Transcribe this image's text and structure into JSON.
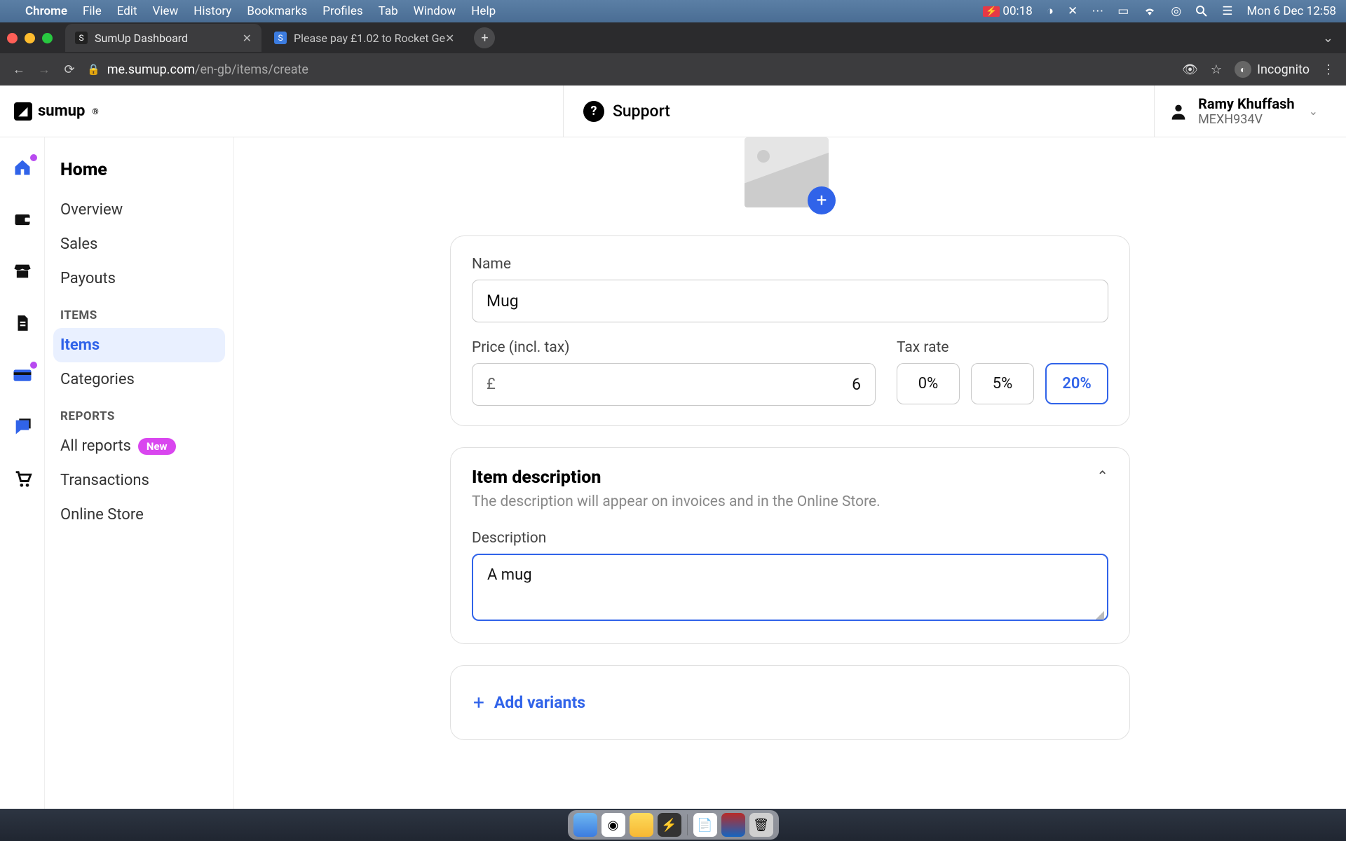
{
  "menubar": {
    "app": "Chrome",
    "menus": [
      "File",
      "Edit",
      "View",
      "History",
      "Bookmarks",
      "Profiles",
      "Tab",
      "Window",
      "Help"
    ],
    "battery_time": "00:18",
    "clock": "Mon 6 Dec  12:58"
  },
  "browser": {
    "tabs": [
      {
        "title": "SumUp Dashboard",
        "active": true
      },
      {
        "title": "Please pay £1.02 to Rocket Ge",
        "active": false
      }
    ],
    "url_host": "me.sumup.com",
    "url_path": "/en-gb/items/create",
    "incognito_label": "Incognito"
  },
  "header": {
    "brand": "sumup",
    "support_label": "Support",
    "user_name": "Ramy Khuffash",
    "user_id": "MEXH934V"
  },
  "sidebar": {
    "current_section": "Home",
    "items_top": [
      "Overview",
      "Sales",
      "Payouts"
    ],
    "group_items": "ITEMS",
    "items_items": [
      "Items",
      "Categories"
    ],
    "group_reports": "REPORTS",
    "items_reports": [
      "All reports",
      "Transactions",
      "Online Store"
    ],
    "new_badge": "New"
  },
  "form": {
    "name_label": "Name",
    "name_value": "Mug",
    "price_label": "Price (incl. tax)",
    "currency": "£",
    "price_value": "6",
    "tax_label": "Tax rate",
    "tax_options": [
      "0%",
      "5%",
      "20%"
    ],
    "tax_selected": "20%",
    "desc_section_title": "Item description",
    "desc_section_sub": "The description will appear on invoices and in the Online Store.",
    "desc_label": "Description",
    "desc_value": "A mug ",
    "add_variants_label": "Add variants"
  }
}
